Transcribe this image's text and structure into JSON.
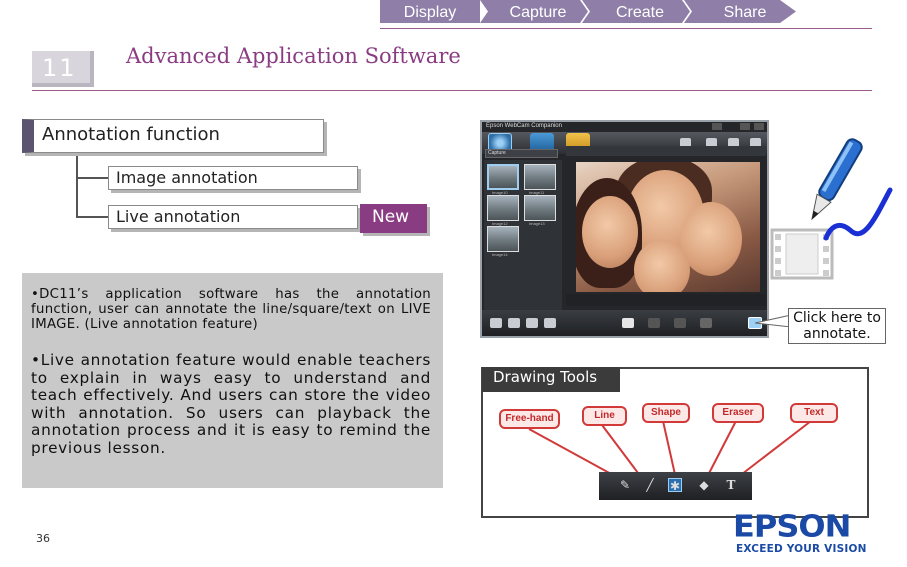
{
  "nav": {
    "items": [
      "Display",
      "Capture",
      "Create",
      "Share"
    ]
  },
  "header": {
    "number": "11",
    "title": "Advanced Application Software"
  },
  "tree": {
    "main": "Annotation function",
    "sub1": "Image annotation",
    "sub2": "Live annotation",
    "badge": "New"
  },
  "body": {
    "para1": "•DC11’s application software has the annotation function, user can annotate the line/square/text on LIVE IMAGE. (Live annotation feature)",
    "para2": "•Live annotation feature would enable teachers to explain in ways easy to understand and teach effectively. And users can store the video with annotation. So users can playback the annotation process and it is easy to remind the previous lesson."
  },
  "page_number": "36",
  "app": {
    "title": "Epson WebCam Companion",
    "dropdown": "Capture",
    "thumb_labels": [
      "Image10",
      "Image11",
      "Image12",
      "Image13",
      "Image14"
    ]
  },
  "callout": "Click here to annotate.",
  "drawing_tools": {
    "header": "Drawing Tools",
    "tools": [
      "Free-hand",
      "Line",
      "Shape",
      "Eraser",
      "Text"
    ]
  },
  "logo": {
    "wordmark": "EPSON",
    "tagline": "EXCEED YOUR VISION"
  },
  "colors": {
    "accent": "#8a3c83",
    "nav": "#8f7fa8",
    "brand": "#1a4aa5"
  }
}
